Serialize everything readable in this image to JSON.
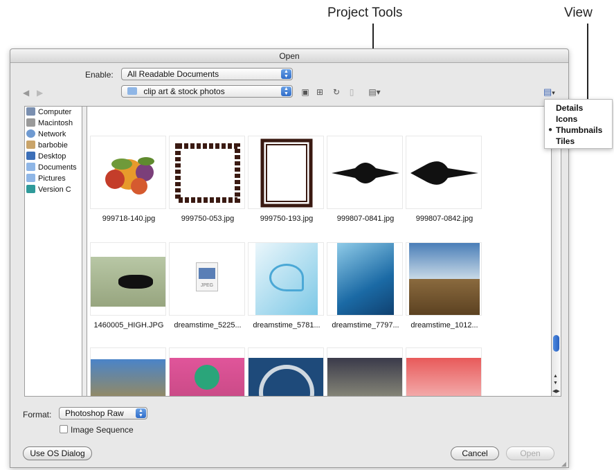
{
  "callouts": {
    "project_tools": "Project Tools",
    "view": "View"
  },
  "window": {
    "title": "Open"
  },
  "enable": {
    "label": "Enable:",
    "value": "All Readable Documents"
  },
  "location": {
    "value": "clip art & stock photos"
  },
  "sidebar": {
    "items": [
      "Computer",
      "Macintosh",
      "Network",
      "barbobie",
      "Desktop",
      "Documents",
      "Pictures",
      "Version C"
    ]
  },
  "thumbnails": {
    "row1": [
      "999718-140.jpg",
      "999750-053.jpg",
      "999750-193.jpg",
      "999807-0841.jpg",
      "999807-0842.jpg"
    ],
    "row2": [
      "1460005_HIGH.JPG",
      "dreamstime_5225...",
      "dreamstime_5781...",
      "dreamstime_7797...",
      "dreamstime_1012..."
    ],
    "jpeg_badge": "JPEG"
  },
  "view_menu": {
    "items": [
      "Details",
      "Icons",
      "Thumbnails",
      "Tiles"
    ],
    "selected": "Thumbnails"
  },
  "format": {
    "label": "Format:",
    "value": "Photoshop Raw"
  },
  "image_sequence": {
    "label": "Image Sequence",
    "checked": false
  },
  "buttons": {
    "os_dialog": "Use OS Dialog",
    "cancel": "Cancel",
    "open": "Open"
  }
}
